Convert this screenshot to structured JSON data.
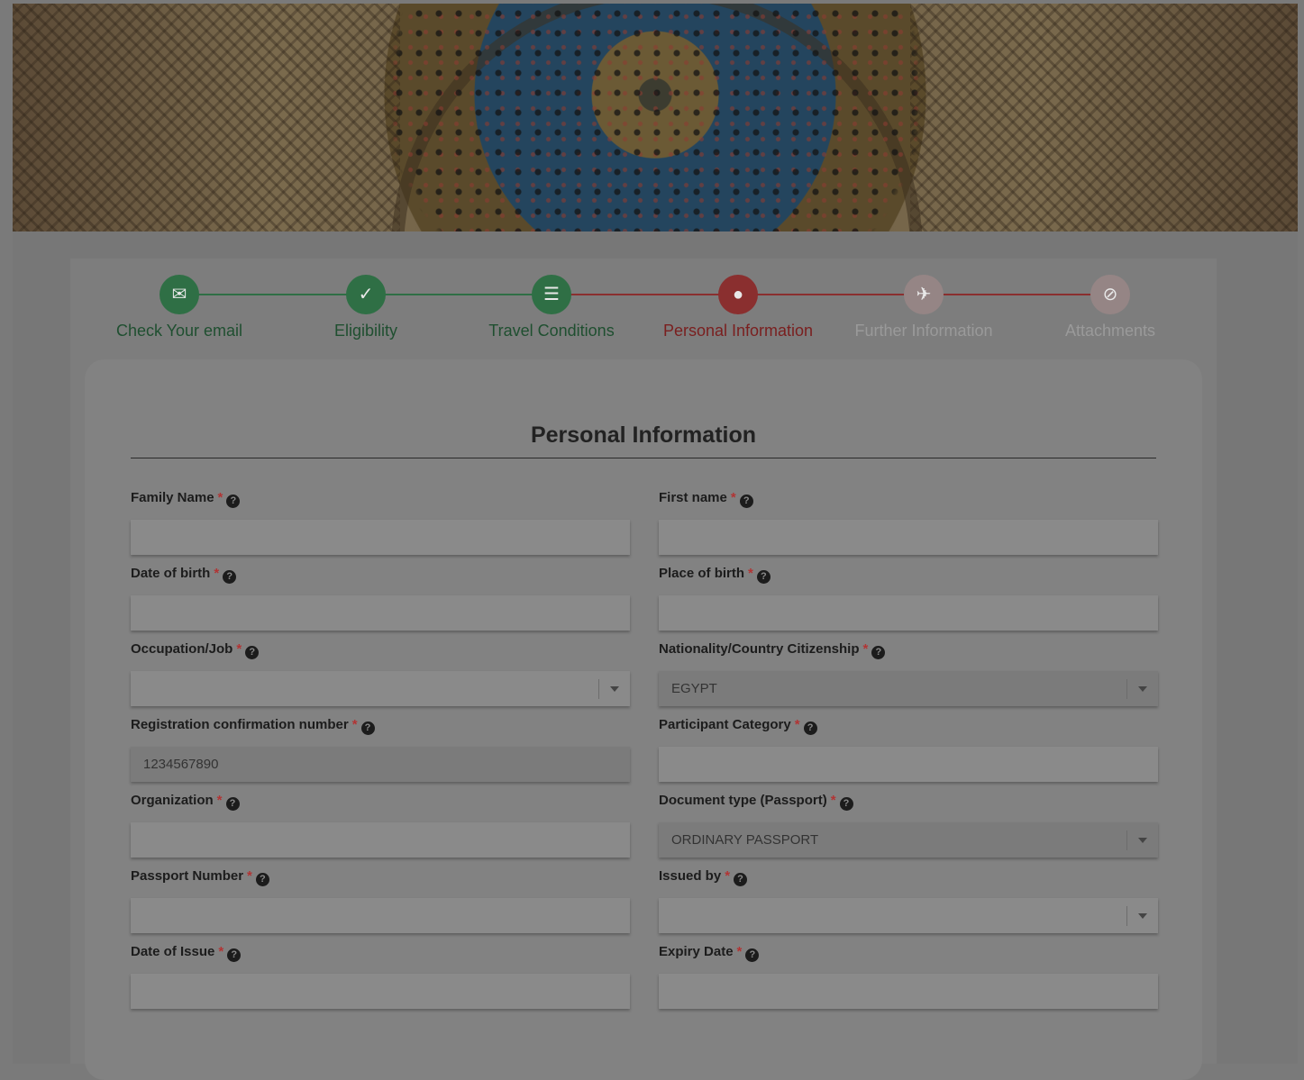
{
  "steps": [
    {
      "label": "Check Your email",
      "icon": "envelope-icon",
      "status": "done",
      "color": "#2f6f45"
    },
    {
      "label": "Eligibility",
      "icon": "eligibility-icon",
      "status": "done",
      "color": "#2f6f45"
    },
    {
      "label": "Travel Conditions",
      "icon": "document-icon",
      "status": "done",
      "color": "#2f6f45"
    },
    {
      "label": "Personal Information",
      "icon": "user-icon",
      "status": "current",
      "color": "#8a2f2f"
    },
    {
      "label": "Further Information",
      "icon": "plane-icon",
      "status": "upcoming",
      "color": "#9a8a8a"
    },
    {
      "label": "Attachments",
      "icon": "paperclip-icon",
      "status": "upcoming",
      "color": "#9a8a8a"
    }
  ],
  "form": {
    "title": "Personal Information",
    "required_mark": "*",
    "help_glyph": "?",
    "fields": {
      "family_name": {
        "label": "Family Name",
        "value": ""
      },
      "first_name": {
        "label": "First name",
        "value": ""
      },
      "date_of_birth": {
        "label": "Date of birth",
        "value": ""
      },
      "place_of_birth": {
        "label": "Place of birth",
        "value": ""
      },
      "occupation": {
        "label": "Occupation/Job",
        "value": ""
      },
      "nationality": {
        "label": "Nationality/Country Citizenship",
        "value": "EGYPT"
      },
      "registration_number": {
        "label": "Registration confirmation number",
        "value": "1234567890"
      },
      "participant_category": {
        "label": "Participant Category",
        "value": ""
      },
      "organization": {
        "label": "Organization",
        "value": ""
      },
      "document_type": {
        "label": "Document type (Passport)",
        "value": "ORDINARY PASSPORT"
      },
      "passport_number": {
        "label": "Passport Number",
        "value": ""
      },
      "issued_by": {
        "label": "Issued by",
        "value": ""
      },
      "date_of_issue": {
        "label": "Date of Issue",
        "value": ""
      },
      "expiry_date": {
        "label": "Expiry Date",
        "value": ""
      }
    }
  }
}
